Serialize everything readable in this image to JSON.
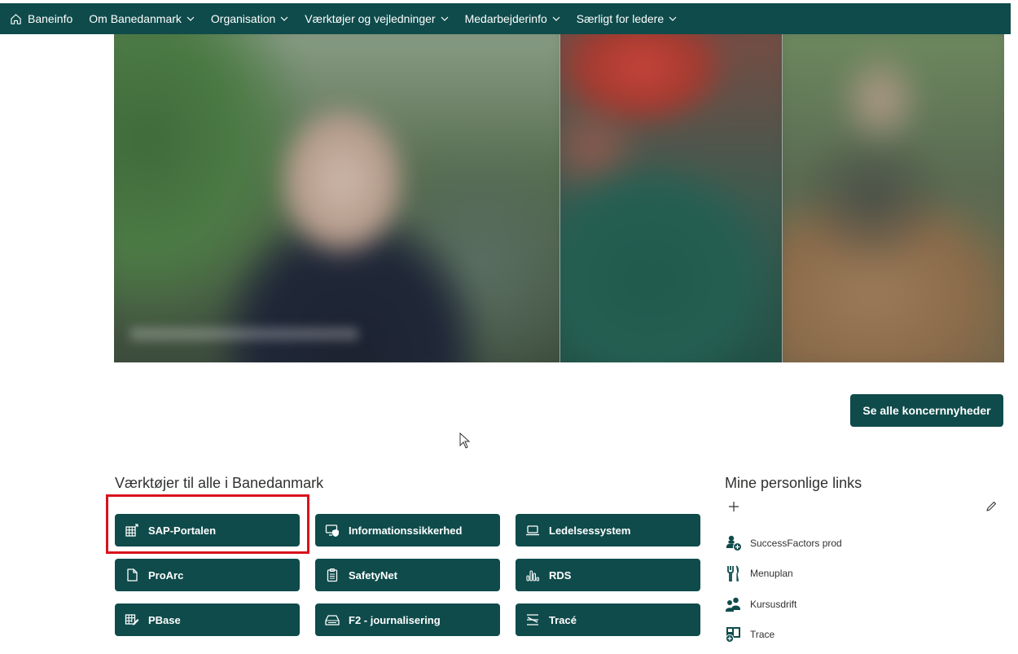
{
  "nav": {
    "home_label": "Baneinfo",
    "items": [
      {
        "label": "Om Banedanmark"
      },
      {
        "label": "Organisation"
      },
      {
        "label": "Værktøjer og vejledninger"
      },
      {
        "label": "Medarbejderinfo"
      },
      {
        "label": "Særligt for ledere"
      }
    ]
  },
  "news": {
    "button_label": "Se alle koncernnyheder"
  },
  "tools": {
    "title": "Værktøjer til alle i Banedanmark",
    "items": [
      {
        "label": "SAP-Portalen",
        "icon": "grid-icon"
      },
      {
        "label": "Informationssikkerhed",
        "icon": "shield-monitor-icon"
      },
      {
        "label": "Ledelsessystem",
        "icon": "laptop-icon"
      },
      {
        "label": "ProArc",
        "icon": "document-icon"
      },
      {
        "label": "SafetyNet",
        "icon": "clipboard-icon"
      },
      {
        "label": "RDS",
        "icon": "bar-chart-icon"
      },
      {
        "label": "PBase",
        "icon": "table-edit-icon"
      },
      {
        "label": "F2 - journalisering",
        "icon": "inbox-icon"
      },
      {
        "label": "Tracé",
        "icon": "align-icon"
      }
    ]
  },
  "personal_links": {
    "title": "Mine personlige links",
    "items": [
      {
        "label": "SuccessFactors prod",
        "icon": "people-add-icon"
      },
      {
        "label": "Menuplan",
        "icon": "food-icon"
      },
      {
        "label": "Kursusdrift",
        "icon": "people-icon"
      },
      {
        "label": "Trace",
        "icon": "board-add-icon"
      }
    ]
  },
  "colors": {
    "primary": "#0f4b4b",
    "highlight": "#d9131b",
    "text": "#323130"
  }
}
